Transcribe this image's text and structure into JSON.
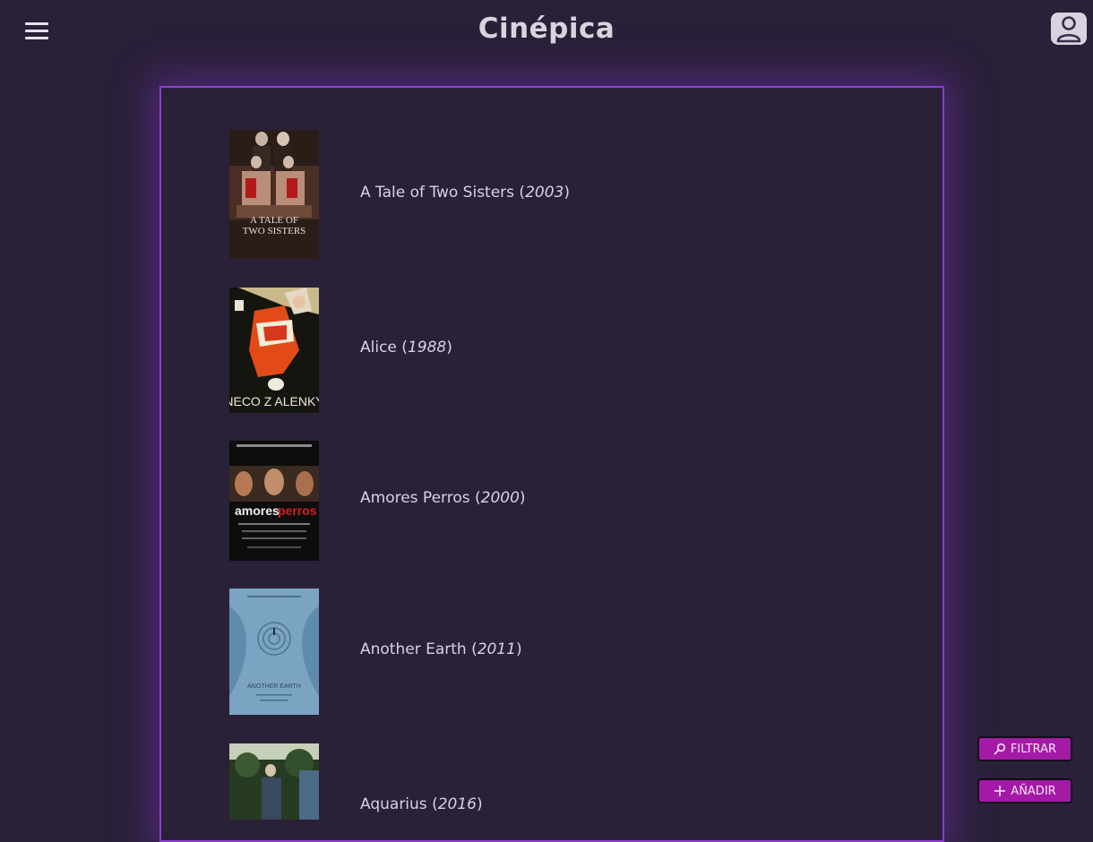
{
  "app": {
    "title": "Cinépica"
  },
  "header": {
    "menu_icon": "hamburger-menu-icon",
    "profile_icon": "user-icon"
  },
  "films": [
    {
      "title": "A Tale of Two Sisters",
      "year": "2003",
      "poster_text": "A TALE OF TWO SISTERS"
    },
    {
      "title": "Alice",
      "year": "1988",
      "poster_text": "NECO Z ALENKY"
    },
    {
      "title": "Amores Perros",
      "year": "2000",
      "poster_text_a": "amores",
      "poster_text_b": "perros"
    },
    {
      "title": "Another Earth",
      "year": "2011",
      "poster_text": "ANOTHER EARTH"
    },
    {
      "title": "Aquarius",
      "year": "2016"
    }
  ],
  "actions": {
    "filter_label": "FILTRAR",
    "add_label": "AÑADIR",
    "filter_icon": "search-icon",
    "add_icon": "plus-icon"
  },
  "colors": {
    "background": "#2a2038",
    "panel_border": "#8a3fd1",
    "action_button": "#a41aa6",
    "text": "#d7d3e0"
  }
}
